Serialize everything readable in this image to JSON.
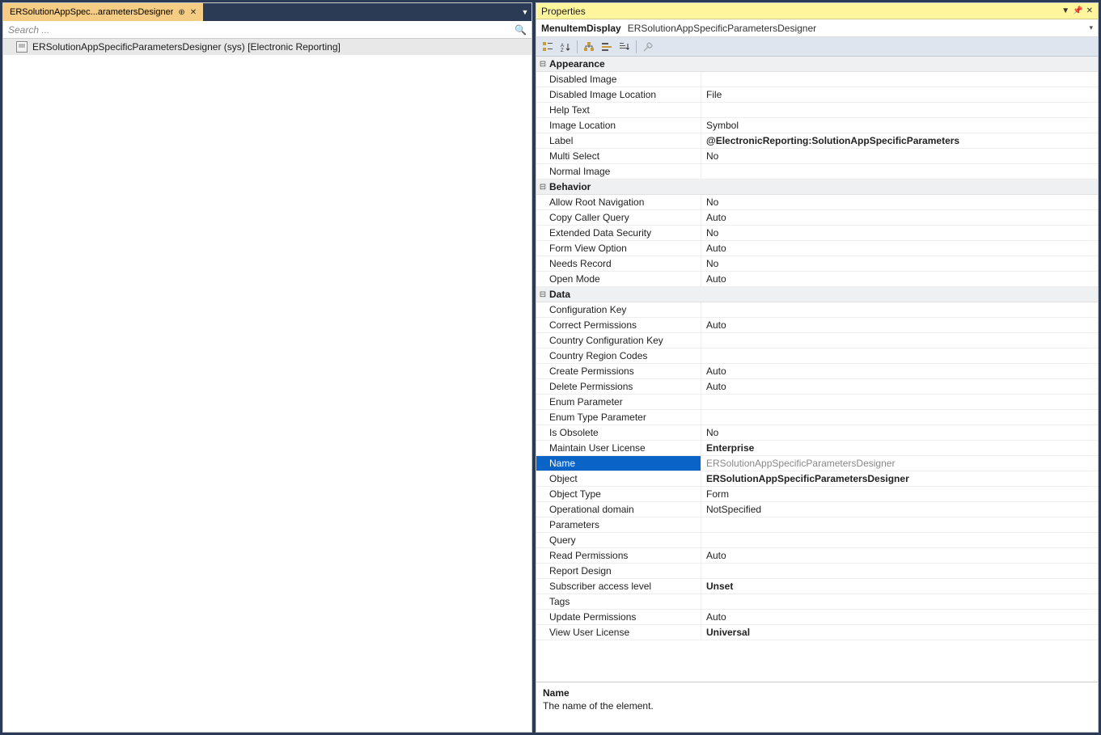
{
  "tab": {
    "title": "ERSolutionAppSpec...arametersDesigner"
  },
  "search": {
    "placeholder": "Search ..."
  },
  "tree": {
    "item_label": "ERSolutionAppSpecificParametersDesigner (sys) [Electronic Reporting]"
  },
  "properties": {
    "panel_title": "Properties",
    "object_type": "MenuItemDisplay",
    "object_name": "ERSolutionAppSpecificParametersDesigner",
    "categories": [
      {
        "name": "Appearance",
        "items": [
          {
            "label": "Disabled Image",
            "value": "",
            "bold": false
          },
          {
            "label": "Disabled Image Location",
            "value": "File",
            "bold": false
          },
          {
            "label": "Help Text",
            "value": "",
            "bold": false
          },
          {
            "label": "Image Location",
            "value": "Symbol",
            "bold": false
          },
          {
            "label": "Label",
            "value": "@ElectronicReporting:SolutionAppSpecificParameters",
            "bold": true
          },
          {
            "label": "Multi Select",
            "value": "No",
            "bold": false
          },
          {
            "label": "Normal Image",
            "value": "",
            "bold": false
          }
        ]
      },
      {
        "name": "Behavior",
        "items": [
          {
            "label": "Allow Root Navigation",
            "value": "No",
            "bold": false
          },
          {
            "label": "Copy Caller Query",
            "value": "Auto",
            "bold": false
          },
          {
            "label": "Extended Data Security",
            "value": "No",
            "bold": false
          },
          {
            "label": "Form View Option",
            "value": "Auto",
            "bold": false
          },
          {
            "label": "Needs Record",
            "value": "No",
            "bold": false
          },
          {
            "label": "Open Mode",
            "value": "Auto",
            "bold": false
          }
        ]
      },
      {
        "name": "Data",
        "items": [
          {
            "label": "Configuration Key",
            "value": "",
            "bold": false
          },
          {
            "label": "Correct Permissions",
            "value": "Auto",
            "bold": false
          },
          {
            "label": "Country Configuration Key",
            "value": "",
            "bold": false
          },
          {
            "label": "Country Region Codes",
            "value": "",
            "bold": false
          },
          {
            "label": "Create Permissions",
            "value": "Auto",
            "bold": false
          },
          {
            "label": "Delete Permissions",
            "value": "Auto",
            "bold": false
          },
          {
            "label": "Enum Parameter",
            "value": "",
            "bold": false
          },
          {
            "label": "Enum Type Parameter",
            "value": "",
            "bold": false
          },
          {
            "label": "Is Obsolete",
            "value": "No",
            "bold": false
          },
          {
            "label": "Maintain User License",
            "value": "Enterprise",
            "bold": true
          },
          {
            "label": "Name",
            "value": "ERSolutionAppSpecificParametersDesigner",
            "bold": false,
            "selected": true
          },
          {
            "label": "Object",
            "value": "ERSolutionAppSpecificParametersDesigner",
            "bold": true
          },
          {
            "label": "Object Type",
            "value": "Form",
            "bold": false
          },
          {
            "label": "Operational domain",
            "value": "NotSpecified",
            "bold": false
          },
          {
            "label": "Parameters",
            "value": "",
            "bold": false
          },
          {
            "label": "Query",
            "value": "",
            "bold": false
          },
          {
            "label": "Read Permissions",
            "value": "Auto",
            "bold": false
          },
          {
            "label": "Report Design",
            "value": "",
            "bold": false
          },
          {
            "label": "Subscriber access level",
            "value": "Unset",
            "bold": true
          },
          {
            "label": "Tags",
            "value": "",
            "bold": false
          },
          {
            "label": "Update Permissions",
            "value": "Auto",
            "bold": false
          },
          {
            "label": "View User License",
            "value": "Universal",
            "bold": true
          }
        ]
      }
    ],
    "description": {
      "title": "Name",
      "text": "The name of the element."
    }
  }
}
